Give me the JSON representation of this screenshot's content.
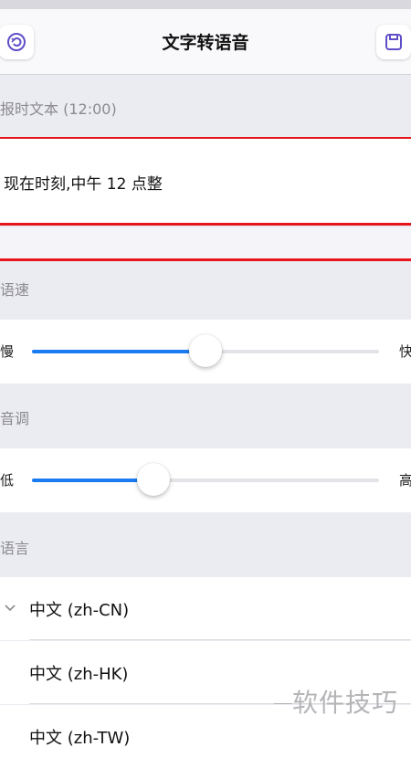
{
  "navbar": {
    "title": "文字转语音",
    "left_icon": "reset-icon",
    "right_icon": "save-icon"
  },
  "text_section": {
    "header": "报时文本 (12:00)",
    "value": "现在时刻,中午 12 点整"
  },
  "speed": {
    "header": "语速",
    "min_label": "慢",
    "max_label": "快",
    "value_fraction": 0.5
  },
  "pitch": {
    "header": "音调",
    "min_label": "低",
    "max_label": "高",
    "value_fraction": 0.35
  },
  "language": {
    "header": "语言",
    "options": [
      {
        "label": "中文 (zh-CN)",
        "selected": true
      },
      {
        "label": "中文 (zh-HK)",
        "selected": false
      },
      {
        "label": "中文 (zh-TW)",
        "selected": false
      }
    ]
  },
  "watermark": "软件技巧",
  "colors": {
    "accent": "#1a7cf0",
    "highlight_line": "#e8141b",
    "background": "#ebebf2"
  }
}
